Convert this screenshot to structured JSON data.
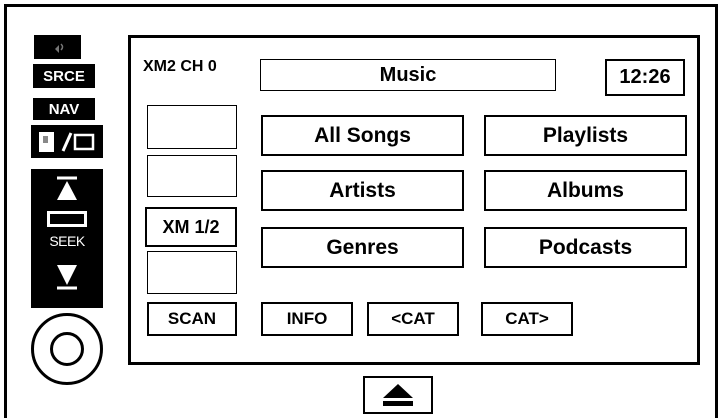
{
  "side": {
    "top_icon": "audio-icon",
    "source_label": "SRCE",
    "nav_label": "NAV",
    "display_icon": "display-toggle-icon",
    "seek_label": "SEEK",
    "knob_icon": "volume-knob-icon"
  },
  "header": {
    "channel": "XM2 CH 0",
    "title": "Music",
    "clock": "12:26"
  },
  "presets": [
    "",
    "",
    "XM 1/2",
    ""
  ],
  "menu": [
    {
      "left": "All Songs",
      "right": "Playlists"
    },
    {
      "left": "Artists",
      "right": "Albums"
    },
    {
      "left": "Genres",
      "right": "Podcasts"
    }
  ],
  "bottom": {
    "scan": "SCAN",
    "info": "INFO",
    "cat_prev": "<CAT",
    "cat_next": "CAT>"
  },
  "eject_icon": "eject-icon"
}
